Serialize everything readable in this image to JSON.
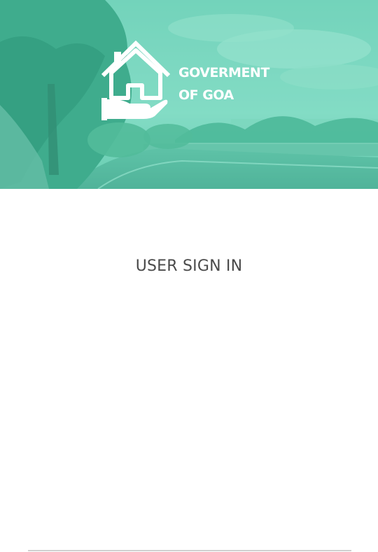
{
  "header": {
    "logo_icon": "house-in-hand-icon",
    "brand_line1": "GOVERMENT",
    "brand_line2": "OF GOA",
    "overlay_color": "#3ec9a7"
  },
  "main": {
    "title": "USER SIGN IN"
  }
}
